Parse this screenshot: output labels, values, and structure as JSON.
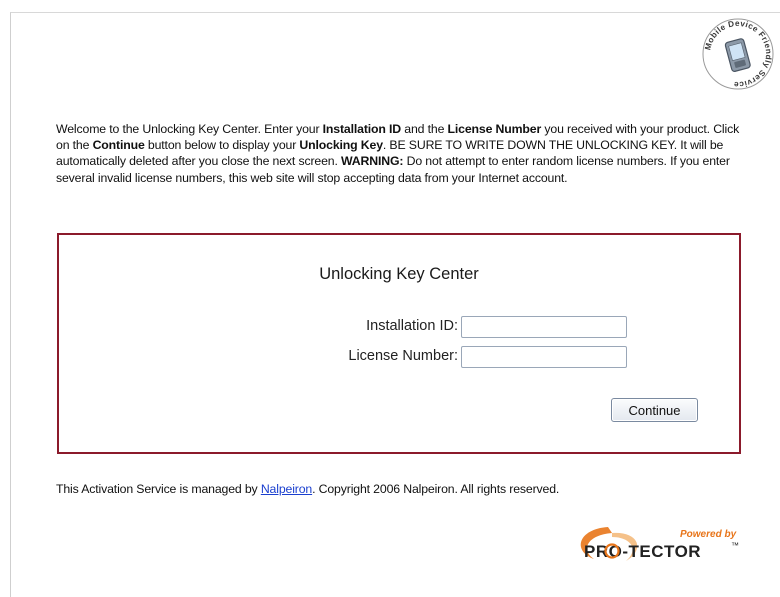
{
  "badge": {
    "text": "Mobile Device Friendly Service",
    "icon": "mobile-device-icon"
  },
  "intro": {
    "p1": "Welcome to the Unlocking Key Center.   Enter your ",
    "b1": "Installation ID",
    "p2": " and the ",
    "b2": "License Number",
    "p3": " you received with your product.   Click on the ",
    "b3": "Continue",
    "p4": " button below to display your ",
    "b4": "Unlocking Key",
    "p5": ".   BE SURE TO WRITE DOWN THE UNLOCKING KEY.   It will be automatically deleted after you close the next screen. ",
    "b5": "WARNING:",
    "p6": "  Do not attempt to enter random license numbers.   If you enter several invalid license numbers, this web site will stop accepting data from your Internet account."
  },
  "form": {
    "title": "Unlocking Key Center",
    "installation_id_label": "Installation ID:",
    "installation_id_value": "",
    "license_number_label": "License Number:",
    "license_number_value": "",
    "continue_label": "Continue",
    "border_color": "#8b1a2b"
  },
  "footer": {
    "prefix": "This Activation Service is managed by ",
    "link_text": "Nalpeiron",
    "suffix": ". Copyright 2006 Nalpeiron. All rights reserved."
  },
  "logo": {
    "powered_by": "Powered by",
    "brand": "PRO-TECTOR",
    "trademark": "™",
    "accent_color": "#e8751a"
  }
}
